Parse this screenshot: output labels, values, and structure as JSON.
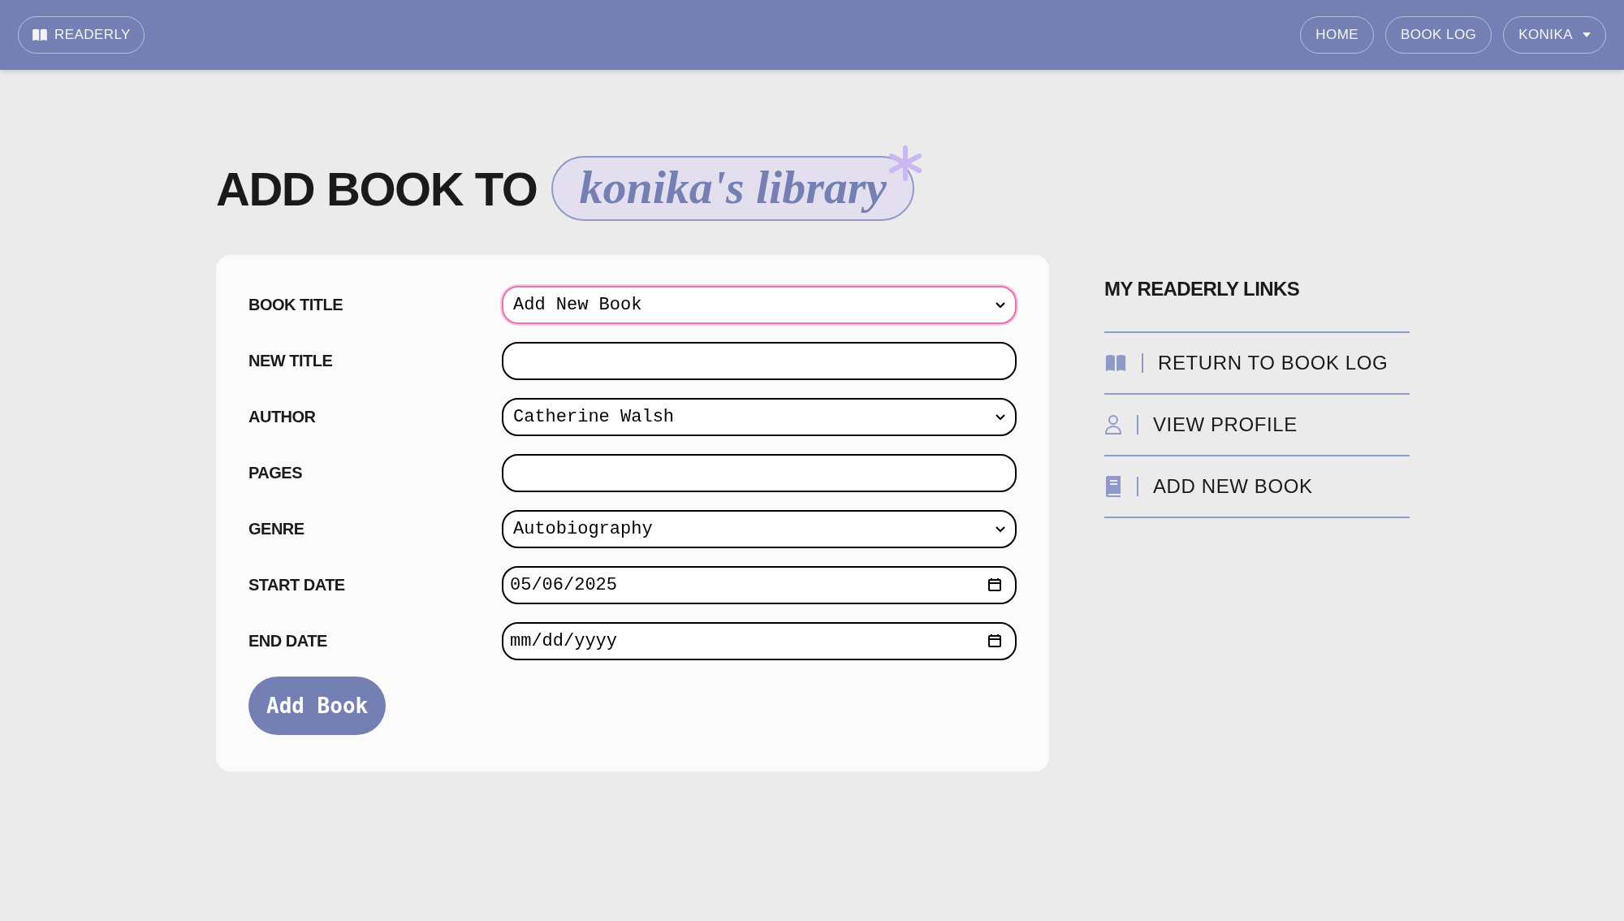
{
  "navbar": {
    "brand": "READERLY",
    "links": [
      {
        "label": "HOME",
        "kind": "link"
      },
      {
        "label": "BOOK LOG",
        "kind": "link"
      },
      {
        "label": "KONIKA",
        "kind": "dropdown"
      }
    ]
  },
  "heading": {
    "text": "ADD BOOK TO",
    "highlight": "konika's library"
  },
  "form": {
    "fields": [
      {
        "label": "BOOK TITLE",
        "kind": "select",
        "value": "Add New Book",
        "focused": true
      },
      {
        "label": "NEW TITLE",
        "kind": "text",
        "focused": false
      },
      {
        "label": "AUTHOR",
        "kind": "select",
        "value": "Catherine Walsh",
        "focused": false
      },
      {
        "label": "PAGES",
        "kind": "text",
        "focused": false
      },
      {
        "label": "GENRE",
        "kind": "select",
        "value": "Autobiography",
        "focused": false
      },
      {
        "label": "START DATE",
        "kind": "date",
        "value": "05/06/2025",
        "focused": false
      },
      {
        "label": "END DATE",
        "kind": "date",
        "placeholder": "mm/dd/yyyy",
        "focused": false
      }
    ],
    "submit": "Add Book"
  },
  "sidebar": {
    "title": "MY READERLY LINKS",
    "links": [
      {
        "label": "RETURN TO BOOK LOG",
        "kind": "book-log"
      },
      {
        "label": "VIEW PROFILE",
        "kind": "profile"
      },
      {
        "label": "ADD NEW BOOK",
        "kind": "add-book"
      }
    ]
  }
}
